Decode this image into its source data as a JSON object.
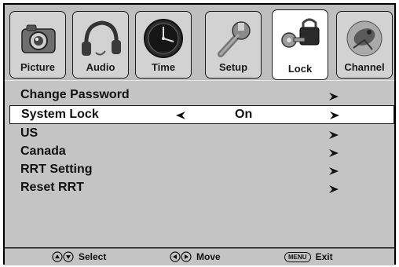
{
  "tabs": [
    {
      "label": "Picture",
      "icon": "camera-icon"
    },
    {
      "label": "Audio",
      "icon": "headphones-icon"
    },
    {
      "label": "Time",
      "icon": "clock-icon"
    },
    {
      "label": "Setup",
      "icon": "wrench-icon"
    },
    {
      "label": "Lock",
      "icon": "key-lock-icon",
      "active": true
    },
    {
      "label": "Channel",
      "icon": "satellite-dish-icon"
    }
  ],
  "menu": {
    "items": [
      {
        "label": "Change Password"
      },
      {
        "label": "System Lock",
        "value": "On",
        "selected": true
      },
      {
        "label": "US"
      },
      {
        "label": "Canada"
      },
      {
        "label": "RRT Setting"
      },
      {
        "label": "Reset RRT"
      }
    ]
  },
  "footer": {
    "select_label": "Select",
    "move_label": "Move",
    "menu_key": "MENU",
    "exit_label": "Exit"
  }
}
